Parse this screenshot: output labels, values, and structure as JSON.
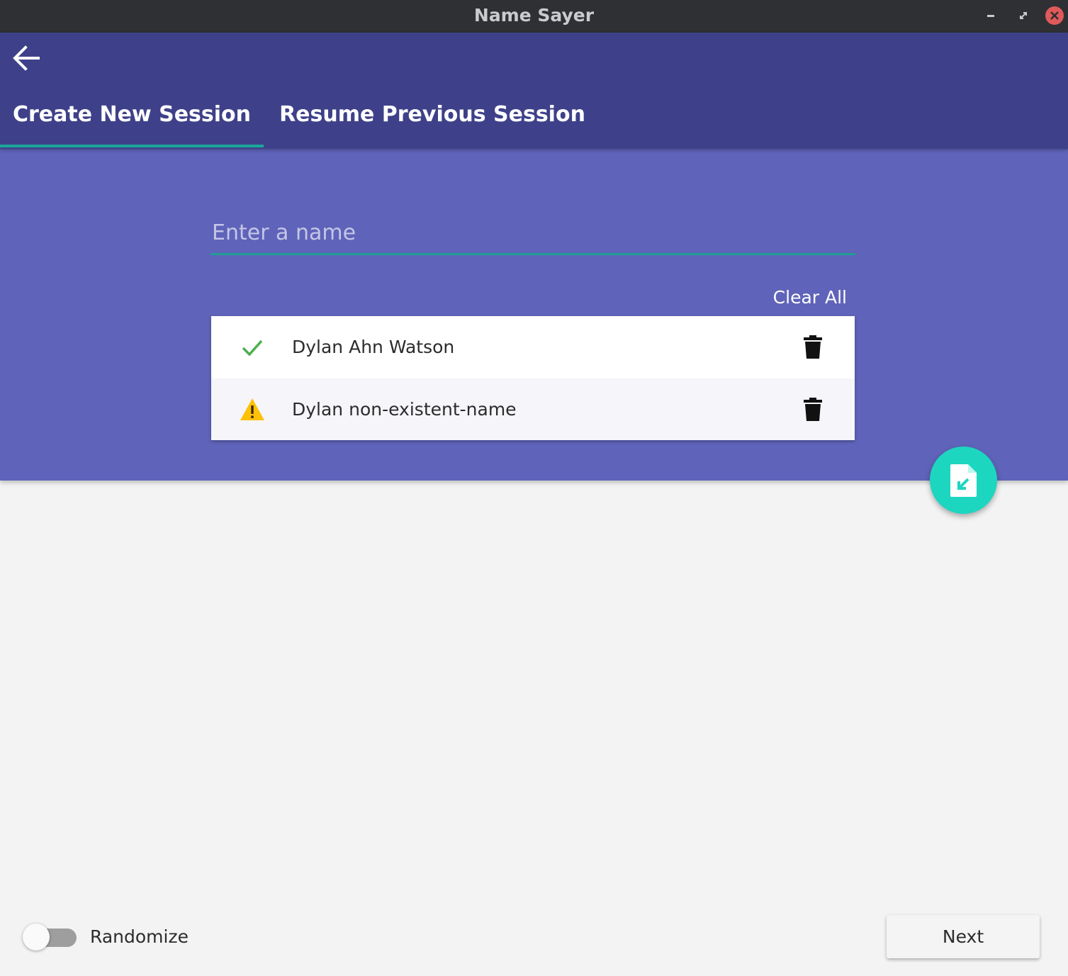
{
  "window": {
    "title": "Name Sayer",
    "controls": [
      "minimize-icon",
      "maximize-icon",
      "close-icon"
    ]
  },
  "header": {
    "back_icon": "arrow-left-icon",
    "tabs": [
      {
        "label": "Create New Session",
        "active": true
      },
      {
        "label": "Resume Previous Session",
        "active": false
      }
    ]
  },
  "session": {
    "name_input": {
      "placeholder": "Enter a name",
      "value": ""
    },
    "clear_all_label": "Clear All",
    "names": [
      {
        "label": "Dylan Ahn Watson",
        "status": "found",
        "status_icon": "check-icon",
        "delete_icon": "trash-icon"
      },
      {
        "label": "Dylan non-existent-name",
        "status": "missing",
        "status_icon": "warning-icon",
        "delete_icon": "trash-icon"
      }
    ],
    "import_fab_icon": "file-import-icon"
  },
  "footer": {
    "randomize": {
      "label": "Randomize",
      "on": false
    },
    "next_label": "Next"
  },
  "colors": {
    "titlebar": "#2e3033",
    "appbar": "#3e4189",
    "panel": "#5f63b9",
    "accent": "#1aa89a",
    "fab": "#1dd6c0",
    "check": "#4caf50",
    "warning": "#ffc107",
    "close": "#e05a5a"
  }
}
